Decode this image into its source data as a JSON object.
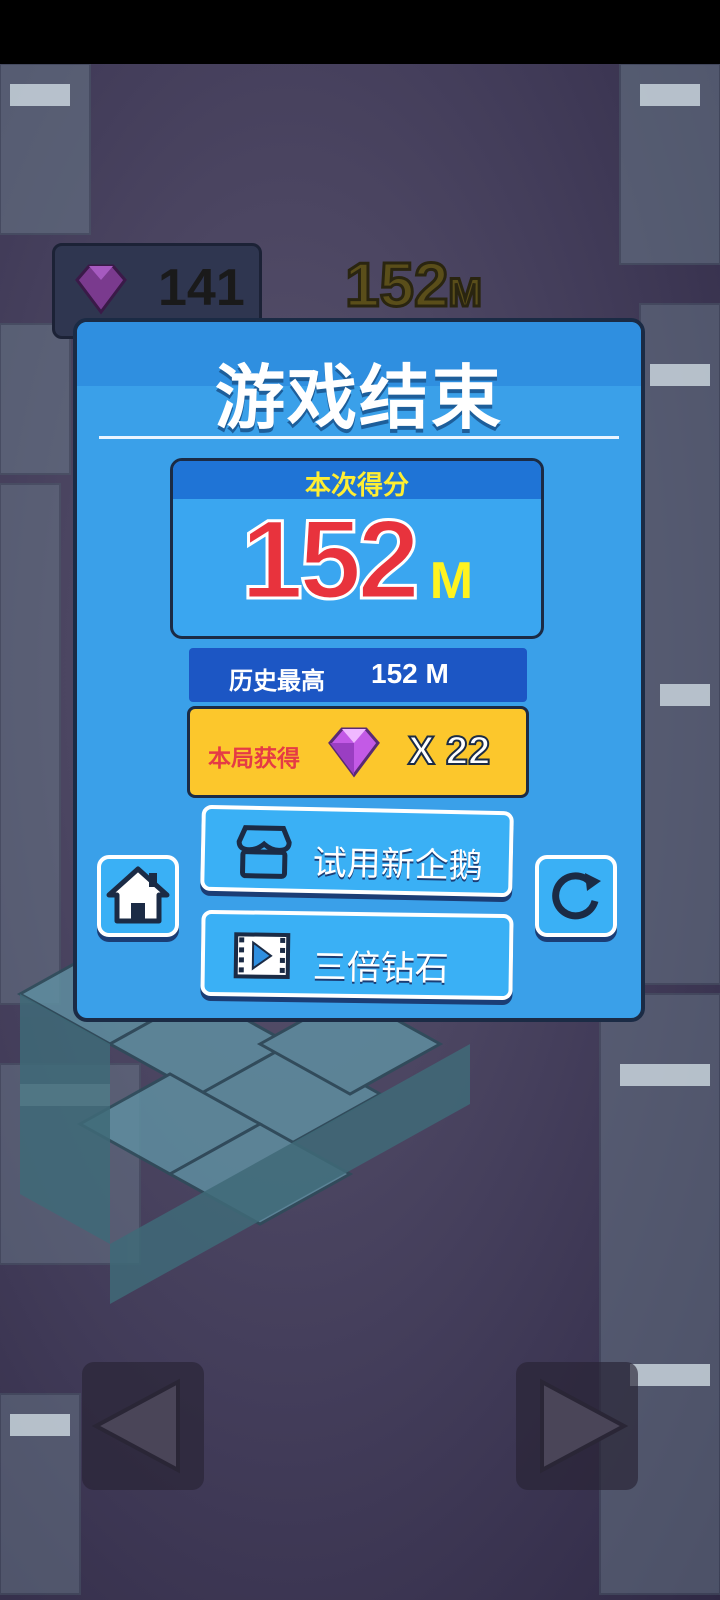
{
  "hud": {
    "gem_count": "141",
    "distance_value": "152",
    "distance_unit": "M"
  },
  "dialog": {
    "title": "游戏结束",
    "score_label": "本次得分",
    "score_value": "152",
    "score_unit": "M",
    "best_label": "历史最高",
    "best_value": "152 M",
    "earned_label": "本局获得",
    "earned_count": "X 22",
    "try_penguin_label": "试用新企鹅",
    "triple_gems_label": "三倍钻石"
  },
  "colors": {
    "panel_blue": "#3aa0e9",
    "score_red": "#e8333d",
    "unit_yellow": "#fff320",
    "earned_bar": "#fcc72c",
    "best_bar": "#1c56c4",
    "gem_purple": "#b04fd6"
  },
  "icons": {
    "home": "home-icon",
    "restart": "restart-icon",
    "shop": "shop-icon",
    "video_ad": "video-ad-icon",
    "gem": "gem-icon",
    "left": "left-arrow-icon",
    "right": "right-arrow-icon"
  }
}
